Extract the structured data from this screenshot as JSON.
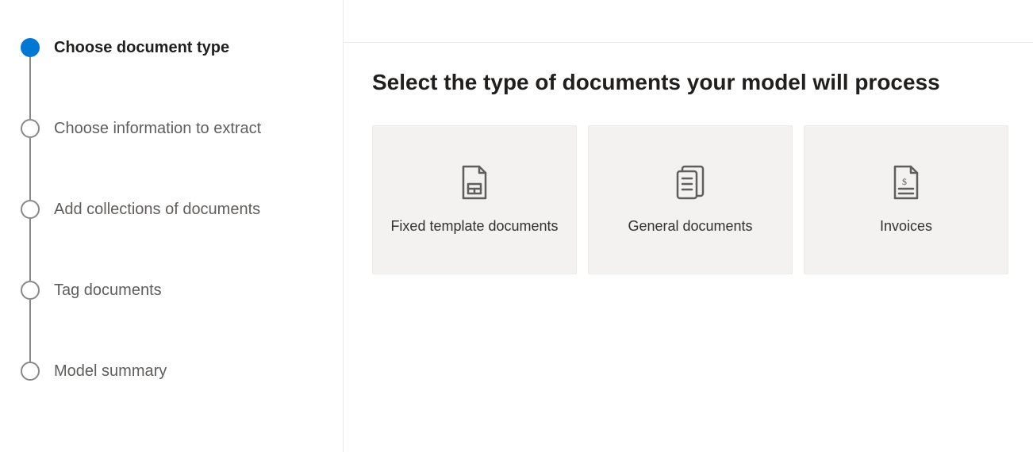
{
  "sidebar": {
    "steps": [
      {
        "label": "Choose document type",
        "active": true
      },
      {
        "label": "Choose information to extract",
        "active": false
      },
      {
        "label": "Add collections of documents",
        "active": false
      },
      {
        "label": "Tag documents",
        "active": false
      },
      {
        "label": "Model summary",
        "active": false
      }
    ]
  },
  "main": {
    "title": "Select the type of documents your model will process",
    "cards": [
      {
        "label": "Fixed template documents",
        "icon": "document-template-icon"
      },
      {
        "label": "General documents",
        "icon": "document-general-icon"
      },
      {
        "label": "Invoices",
        "icon": "document-invoice-icon"
      }
    ]
  }
}
